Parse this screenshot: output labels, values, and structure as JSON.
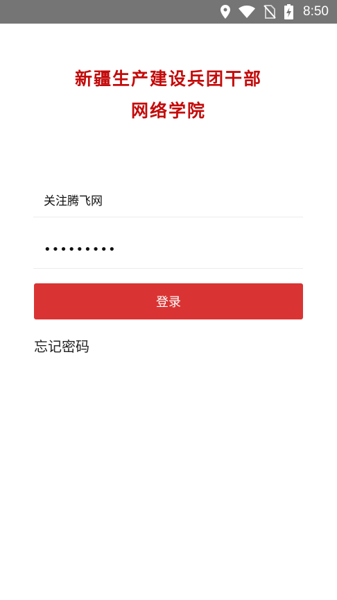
{
  "status_bar": {
    "time": "8:50",
    "icons": [
      "location-icon",
      "wifi-icon",
      "no-sim-icon",
      "battery-charging-icon"
    ]
  },
  "header": {
    "title_line1": "新疆生产建设兵团干部",
    "title_line2": "网络学院",
    "color": "#c40a0a"
  },
  "form": {
    "username_value": "关注腾飞网",
    "password_value": "•••••••••",
    "login_label": "登录",
    "forgot_label": "忘记密码",
    "accent_color": "#d93433"
  }
}
